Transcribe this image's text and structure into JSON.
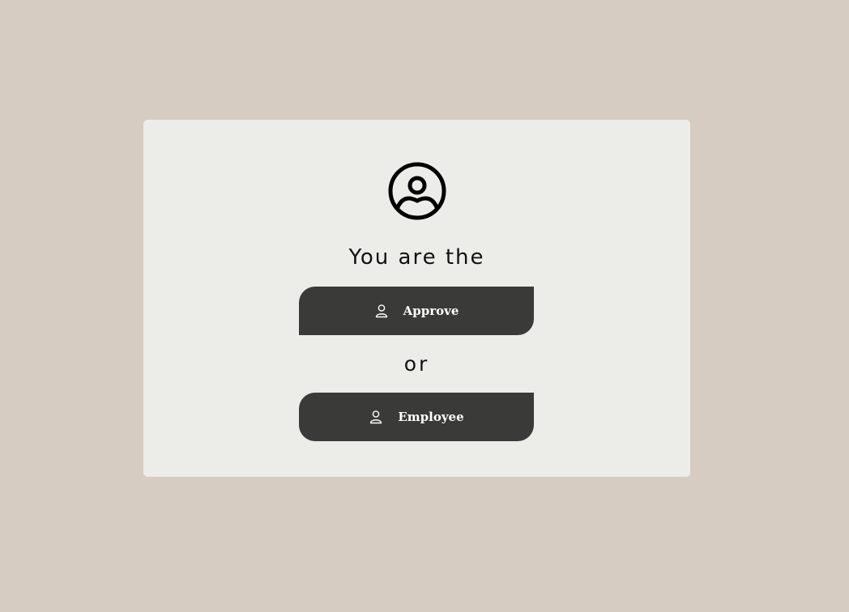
{
  "card": {
    "avatar_icon": "user-circle-icon",
    "heading": "You are the",
    "separator": "or"
  },
  "buttons": [
    {
      "label": "Approve",
      "icon": "user-icon"
    },
    {
      "label": "Employee",
      "icon": "user-icon"
    }
  ],
  "colors": {
    "page_background": "#d7ccc2",
    "card_background": "#ecece8",
    "button_background": "#3a3a38",
    "button_text": "#ffffff"
  }
}
